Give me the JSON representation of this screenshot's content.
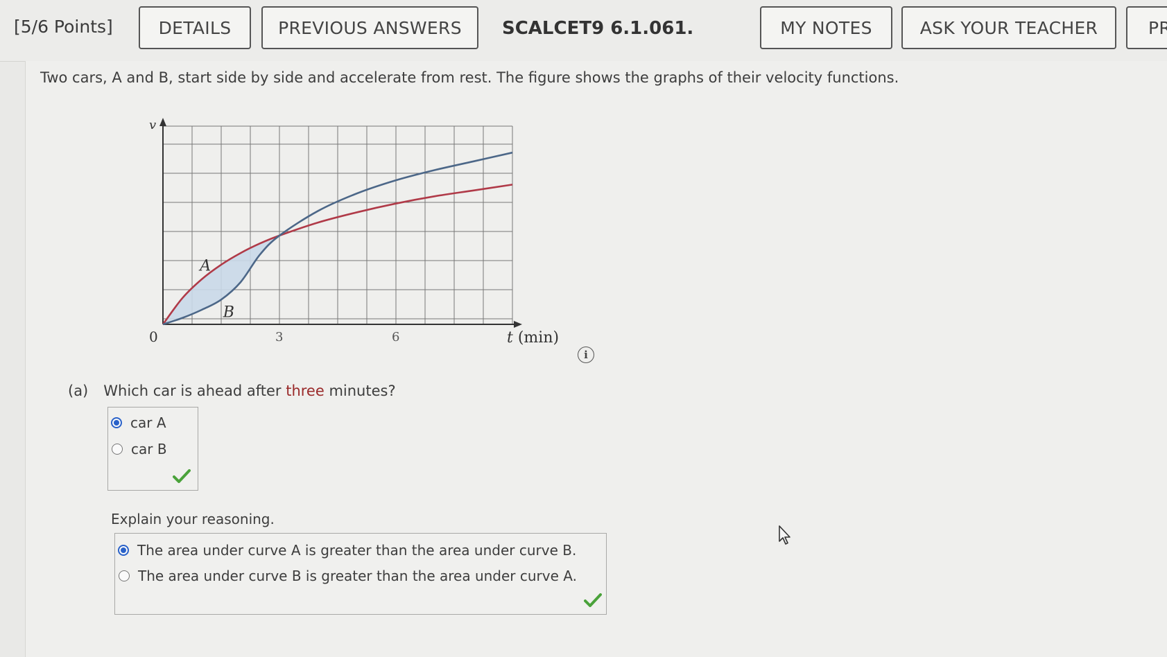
{
  "toolbar": {
    "points": "[5/6 Points]",
    "details": "DETAILS",
    "previous_answers": "PREVIOUS ANSWERS",
    "problem_code": "SCALCET9 6.1.061.",
    "my_notes": "MY NOTES",
    "ask_teacher": "ASK YOUR TEACHER",
    "next_cut": "PR"
  },
  "question": {
    "text": "Two cars, A and B, start side by side and accelerate from rest. The figure shows the graphs of their velocity functions."
  },
  "chart_data": {
    "type": "line",
    "ylabel": "v",
    "xlabel": "t (min)",
    "x_ticks": [
      "0",
      "3",
      "6"
    ],
    "xlim": [
      0,
      9
    ],
    "grid": true,
    "annotations": [
      "A",
      "B"
    ],
    "series": [
      {
        "name": "A",
        "color": "#b03a48",
        "x": [
          0,
          0.5,
          1,
          1.5,
          2,
          2.5,
          3,
          4,
          5,
          6,
          7,
          8,
          9
        ],
        "y": [
          0,
          0.9,
          1.55,
          2.05,
          2.45,
          2.78,
          3.05,
          3.5,
          3.85,
          4.15,
          4.4,
          4.6,
          4.8
        ]
      },
      {
        "name": "B",
        "color": "#4c6788",
        "x": [
          0,
          0.5,
          1,
          1.5,
          2,
          2.5,
          3,
          4,
          5,
          6,
          7,
          8,
          9
        ],
        "y": [
          0,
          0.22,
          0.5,
          0.85,
          1.45,
          2.4,
          3.05,
          3.9,
          4.5,
          4.95,
          5.3,
          5.6,
          5.9
        ]
      }
    ]
  },
  "part_a": {
    "label": "(a)",
    "question_pre": "Which car is ahead after ",
    "question_highlight": "three",
    "question_post": " minutes?",
    "options": [
      "car A",
      "car B"
    ],
    "selected": "car A",
    "status": "correct"
  },
  "reasoning": {
    "prompt": "Explain your reasoning.",
    "options": [
      "The area under curve A is greater than the area under curve B.",
      "The area under curve B is greater than the area under curve A."
    ],
    "selected": "The area under curve A is greater than the area under curve B.",
    "status": "correct"
  },
  "colors": {
    "correct": "#4aa23a",
    "radio_selected": "#2a62c9",
    "highlight": "#9a2a2a"
  }
}
